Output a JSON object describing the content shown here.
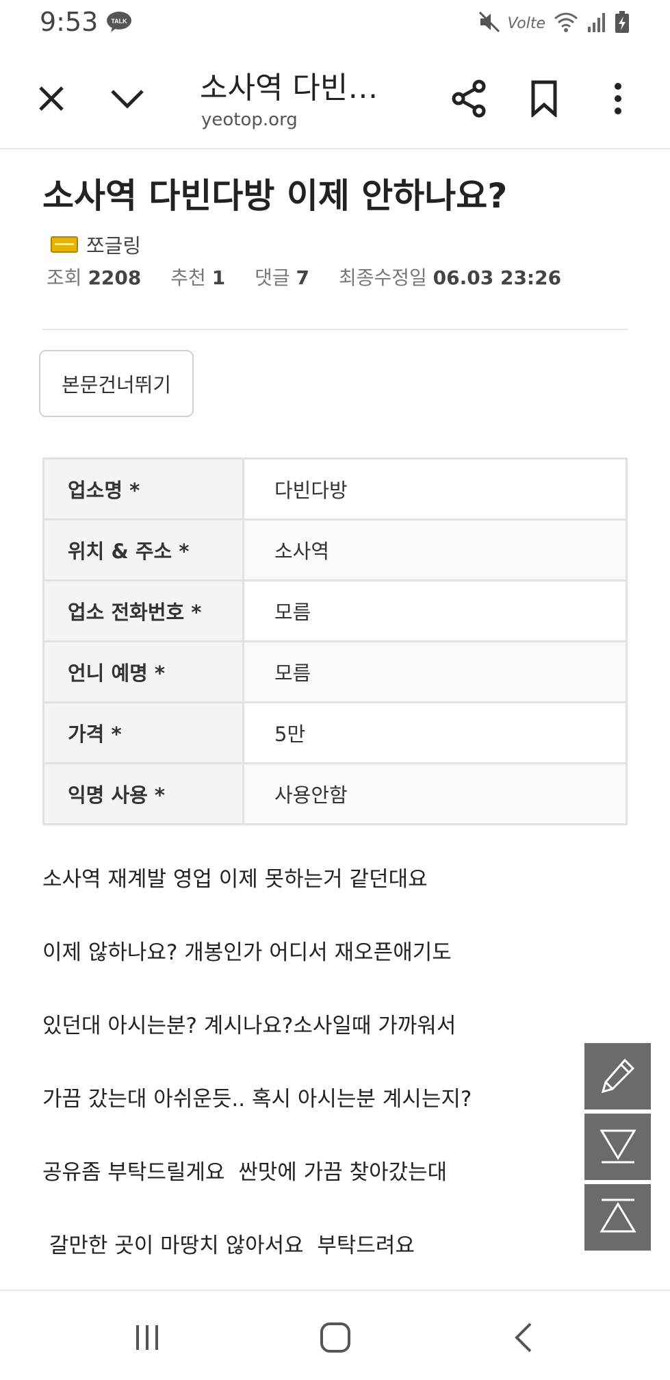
{
  "status_bar": {
    "time": "9:53",
    "talk_badge": "TALK",
    "network": "Volte"
  },
  "browser": {
    "close_icon": "close-icon",
    "collapse_icon": "chevron-down-icon",
    "page_title": "소사역 다빈…",
    "url": "yeotop.org",
    "share_icon": "share-icon",
    "bookmark_icon": "bookmark-icon",
    "menu_icon": "more-vertical-icon"
  },
  "post": {
    "title": "소사역 다빈다방 이제 안하나요?",
    "author": "쪼글링",
    "meta": {
      "views_label": "조회",
      "views": "2208",
      "recommend_label": "추천",
      "recommend": "1",
      "comments_label": "댓글",
      "comments": "7",
      "modified_label": "최종수정일",
      "modified": "06.03 23:26"
    },
    "skip_button": "본문건너뛰기",
    "info_table": [
      {
        "key": "업소명 *",
        "value": "다빈다방"
      },
      {
        "key": "위치 & 주소 *",
        "value": "소사역"
      },
      {
        "key": "업소 전화번호 *",
        "value": "모름"
      },
      {
        "key": "언니 예명 *",
        "value": "모름"
      },
      {
        "key": "가격 *",
        "value": "5만"
      },
      {
        "key": "익명 사용 *",
        "value": "사용안함"
      }
    ],
    "body_lines": [
      "소사역 재계발 영업 이제 못하는거 같던대요",
      "이제 않하나요? 개봉인가 어디서 재오픈애기도",
      "있던대 아시는분? 계시나요?소사일때 가까워서",
      "가끔 갔는대 아쉬운듯.. 혹시 아시는분 계시는지?",
      "공유좀 부탁드릴게요  싼맛에 가끔 찾아갔는대",
      " 갈만한 곳이 마땅치 않아서요  부탁드려요"
    ]
  },
  "floating_buttons": [
    "pencil-icon",
    "scroll-down-icon",
    "scroll-up-icon"
  ],
  "nav_bar": [
    "recent-apps-icon",
    "home-icon",
    "back-icon"
  ],
  "colors": {
    "fab_bg": "#6b6b6b",
    "table_header_bg": "#f4f4f4",
    "badge": "#e6b400"
  }
}
